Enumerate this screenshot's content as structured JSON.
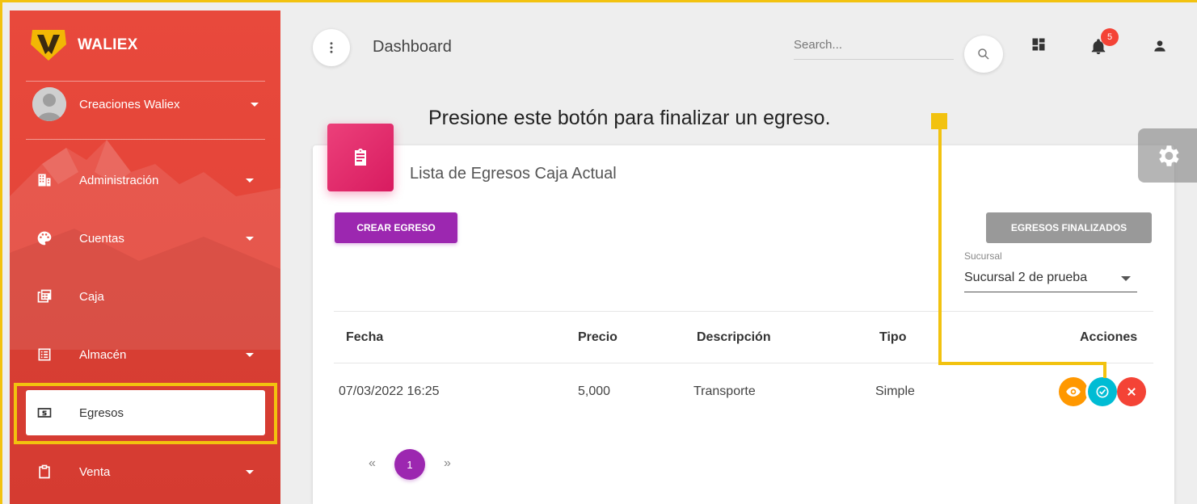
{
  "brand": {
    "name": "WALIEX"
  },
  "user": {
    "name": "Creaciones Waliex"
  },
  "sidebar": {
    "items": [
      {
        "label": "Administración",
        "icon": "building-icon",
        "has_submenu": true
      },
      {
        "label": "Cuentas",
        "icon": "palette-icon",
        "has_submenu": true
      },
      {
        "label": "Caja",
        "icon": "cash-register-icon",
        "has_submenu": false
      },
      {
        "label": "Almacén",
        "icon": "list-box-icon",
        "has_submenu": true
      },
      {
        "label": "Egresos",
        "icon": "money-icon",
        "has_submenu": false,
        "active": true
      },
      {
        "label": "Venta",
        "icon": "clipboard-icon",
        "has_submenu": true
      }
    ]
  },
  "header": {
    "title": "Dashboard",
    "search_placeholder": "Search...",
    "notifications_count": "5"
  },
  "annotation": {
    "text": "Presione este botón para finalizar un egreso."
  },
  "card": {
    "title": "Lista de Egresos Caja Actual",
    "create_button": "CREAR EGRESO",
    "finalized_button": "EGRESOS FINALIZADOS",
    "select_label": "Sucursal",
    "select_value": "Sucursal 2 de prueba"
  },
  "table": {
    "headers": [
      "Fecha",
      "Precio",
      "Descripción",
      "Tipo",
      "Acciones"
    ],
    "rows": [
      {
        "fecha": "07/03/2022 16:25",
        "precio": "5,000",
        "descripcion": "Transporte",
        "tipo": "Simple"
      }
    ]
  },
  "pagination": {
    "prev": "«",
    "current": "1",
    "next": "»"
  },
  "colors": {
    "sidebar": "#e8493c",
    "accent_purple": "#9c27b0",
    "card_icon_pink": "#e91e63",
    "highlight": "#f2c20f",
    "view_orange": "#ff9800",
    "finalize_cyan": "#00bcd4",
    "delete_red": "#f44336"
  }
}
